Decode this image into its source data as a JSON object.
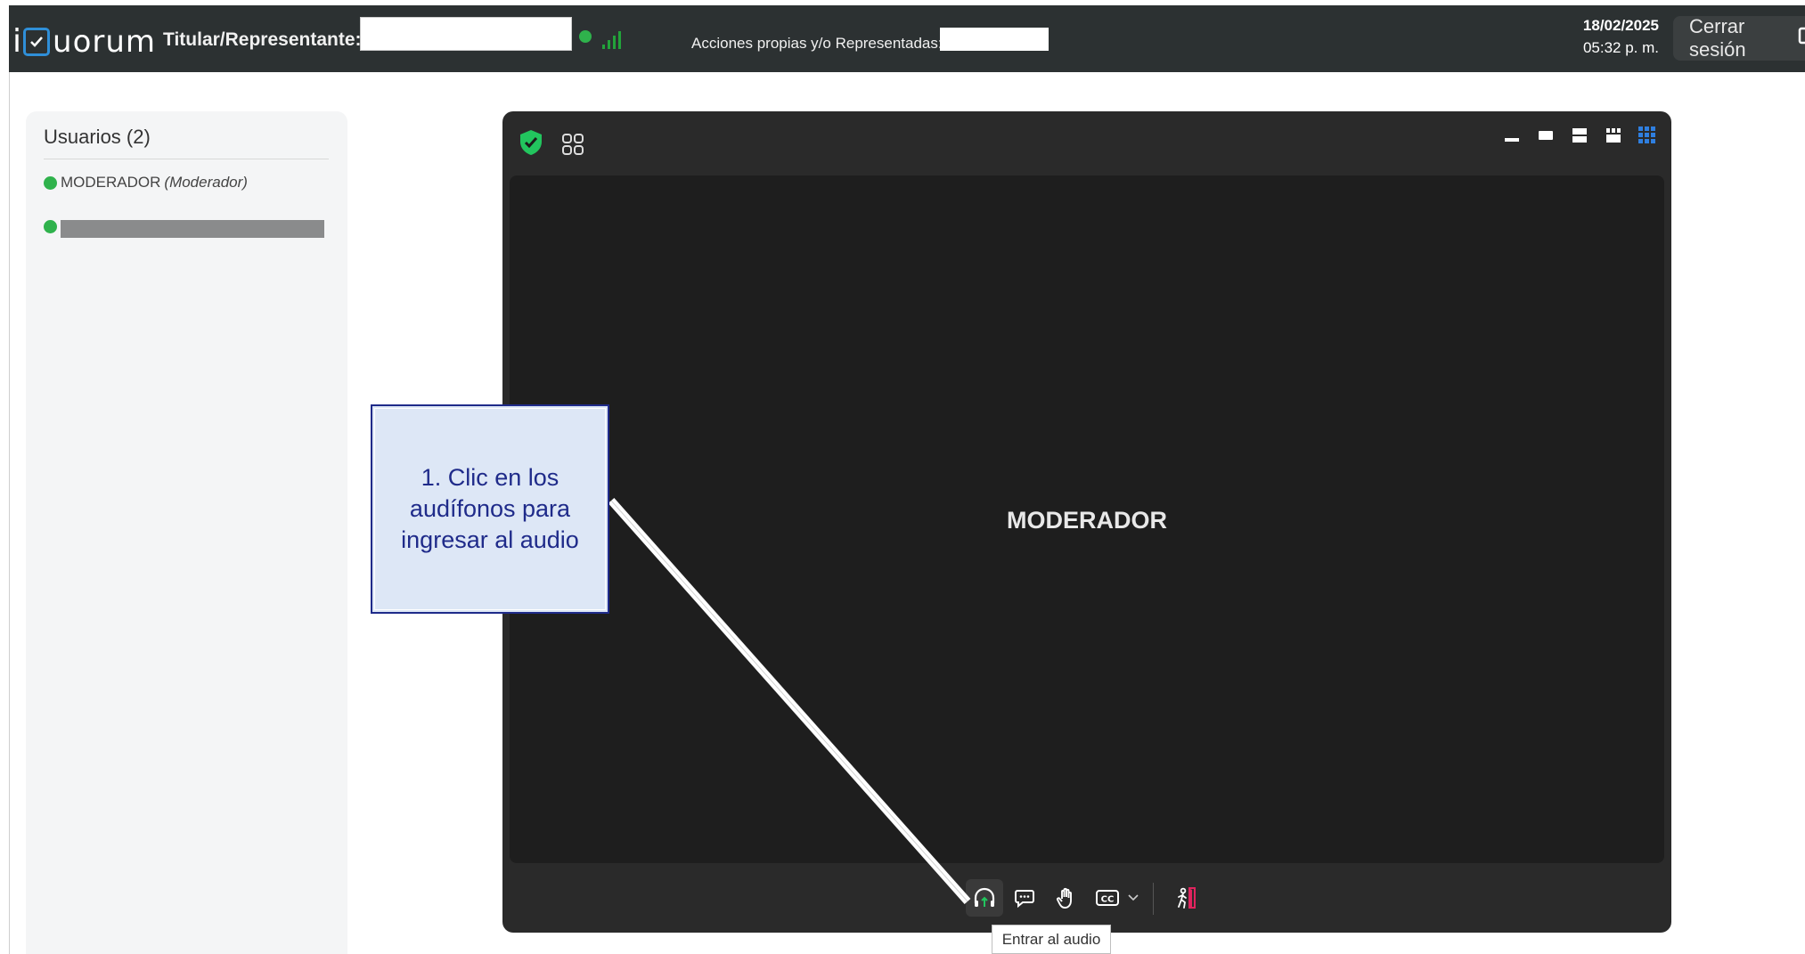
{
  "header": {
    "logo_i": "i",
    "logo_text": "uorum",
    "titular_label": "Titular/Representante:",
    "titular_value": "",
    "acciones_label": "Acciones propias y/o Representadas:",
    "acciones_value": "",
    "date": "18/02/2025",
    "time": "05:32 p. m.",
    "logout_label": "Cerrar sesión"
  },
  "users": {
    "title": "Usuarios (2)",
    "items": [
      {
        "name": "MODERADOR",
        "role": "(Moderador)",
        "status_color": "#2fb24c"
      },
      {
        "name": "",
        "role": "",
        "status_color": "#2fb24c"
      }
    ]
  },
  "meeting": {
    "participant_name": "MODERADOR",
    "layout_buttons": [
      "minimize-layout-icon",
      "single-layout-icon",
      "stacked-layout-icon",
      "four-grid-layout-icon",
      "nine-grid-layout-icon"
    ],
    "controls": [
      "headphones-icon",
      "chat-icon",
      "raise-hand-icon",
      "closed-captions-icon",
      "chevron-down-icon",
      "leave-meeting-icon"
    ],
    "tooltip": "Entrar al audio"
  },
  "callout": {
    "text": "1. Clic en los audífonos para ingresar al audio"
  },
  "colors": {
    "topbar": "#2c3132",
    "accent_blue": "#2f8fd8",
    "online_green": "#2fb24c",
    "shield_green": "#22c55e",
    "leave_red": "#e0245e",
    "callout_border": "#1f2b8a"
  }
}
